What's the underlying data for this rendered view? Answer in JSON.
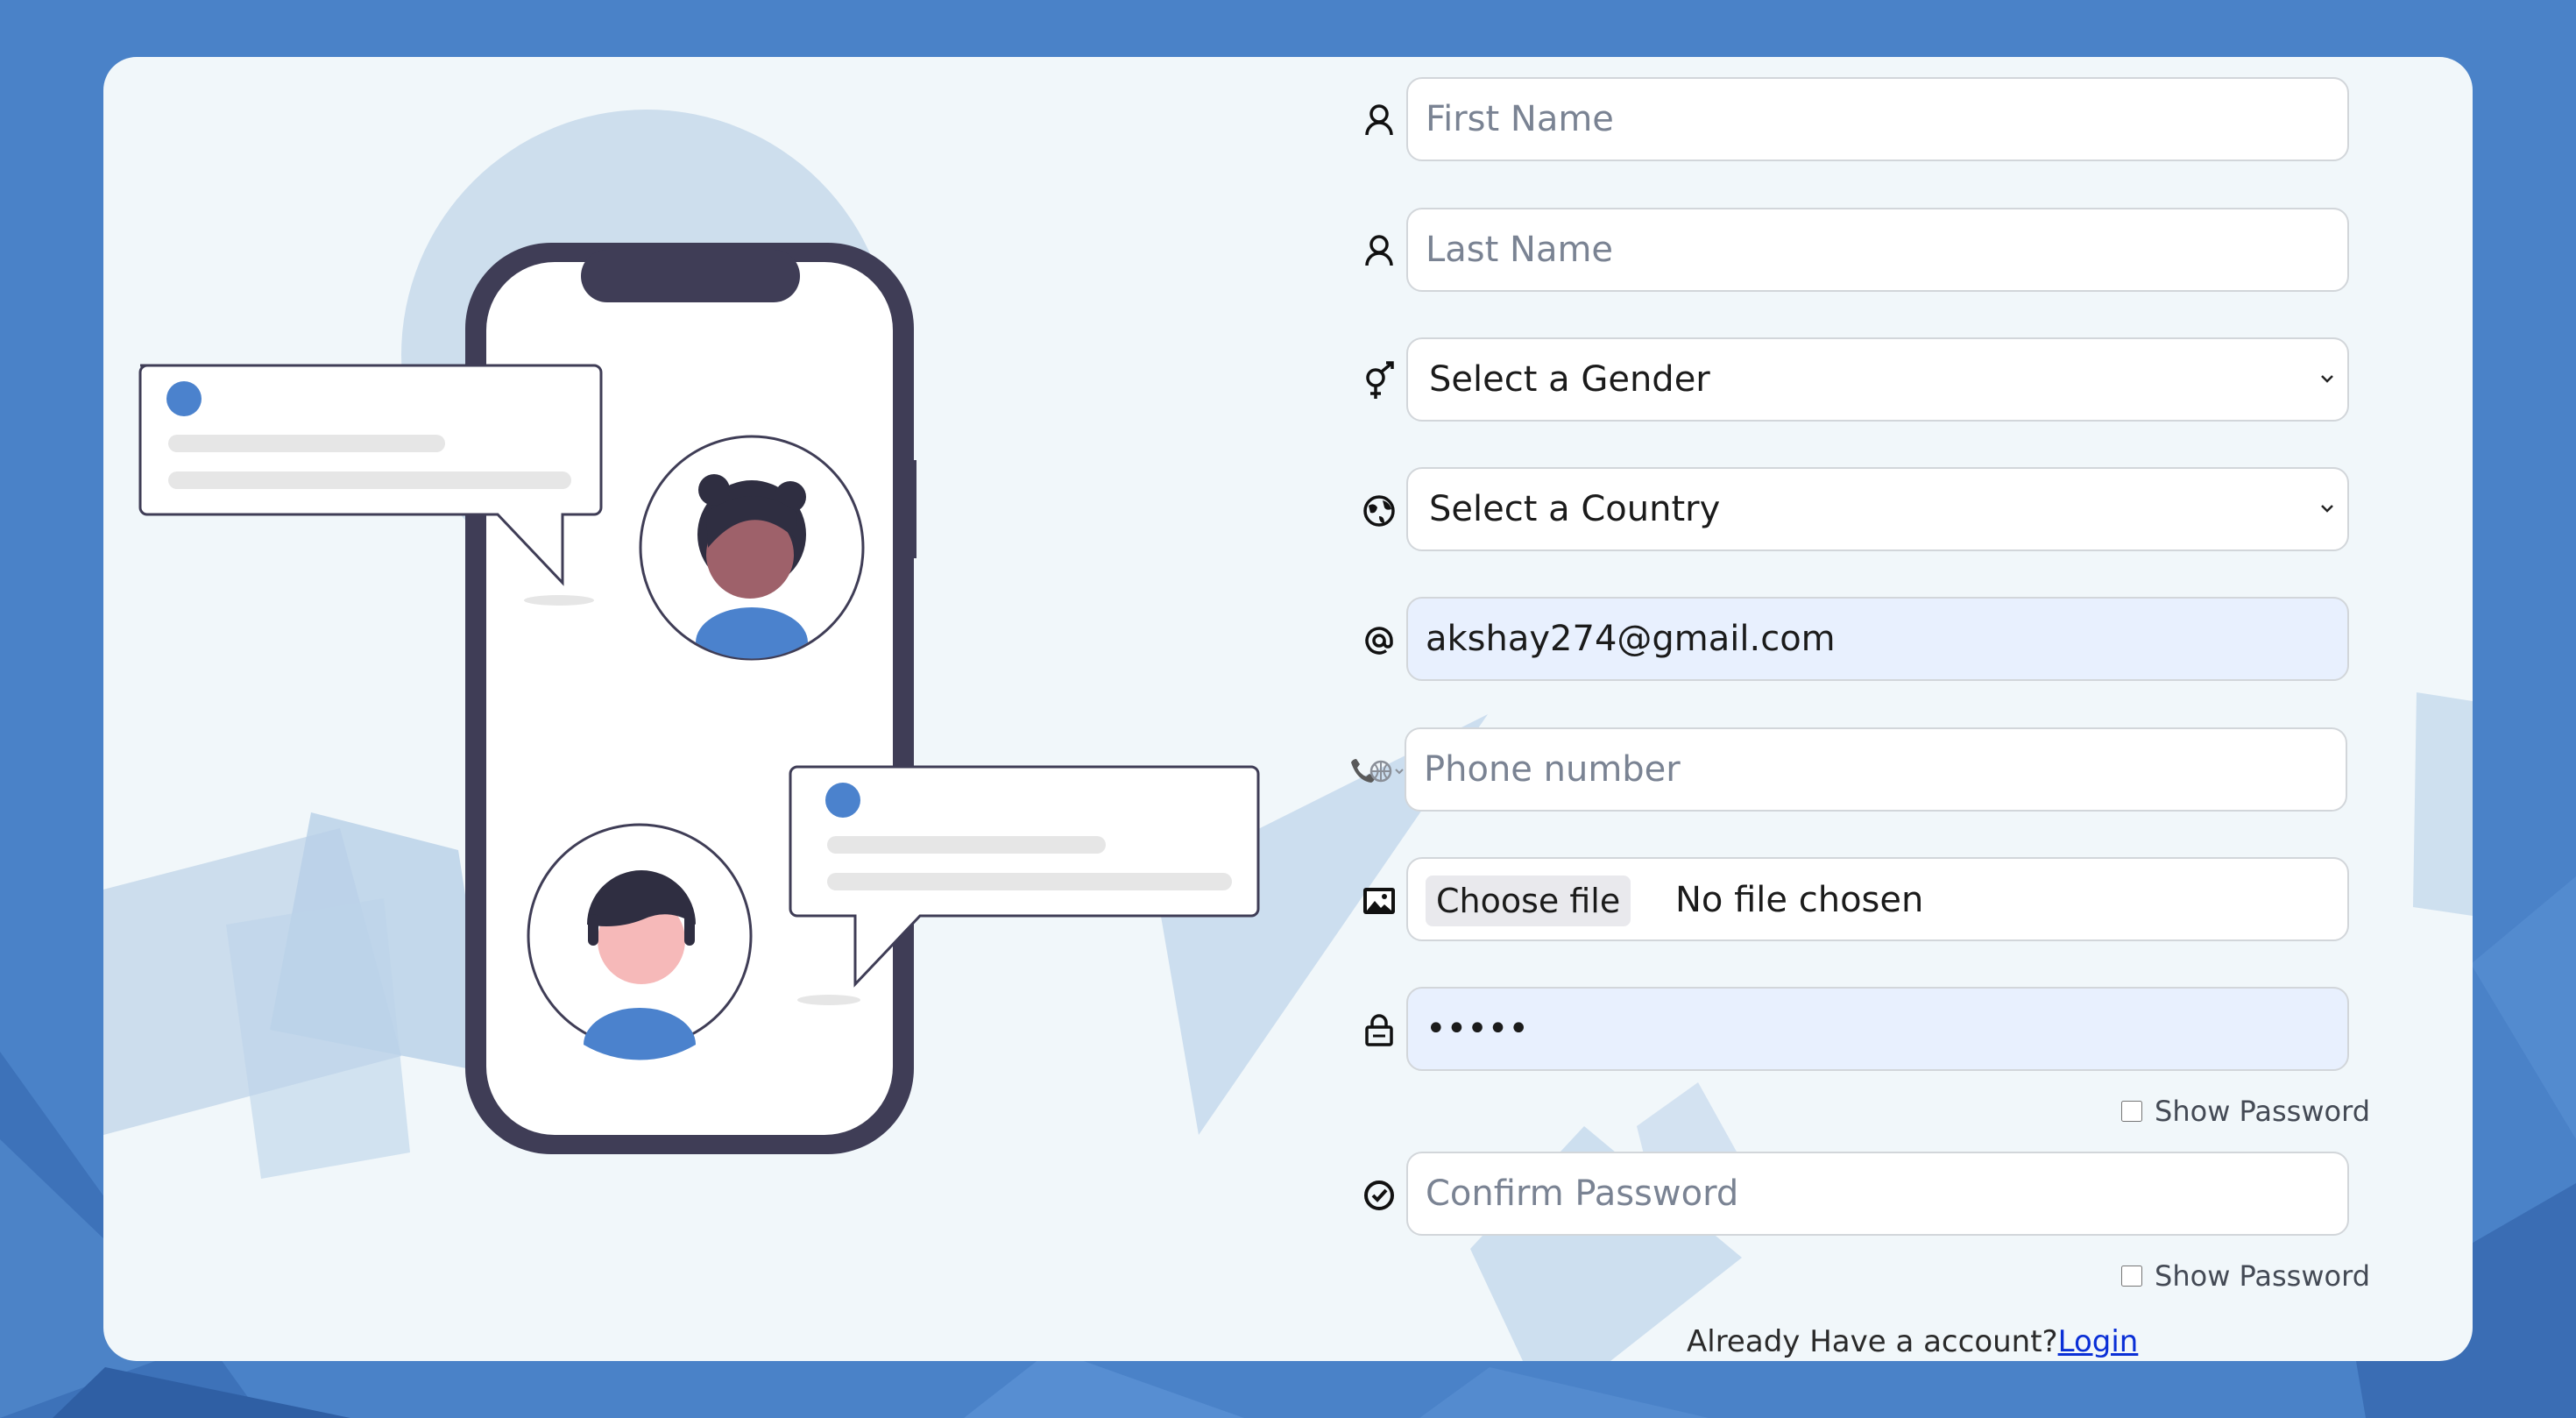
{
  "form": {
    "first_name": {
      "placeholder": "First Name",
      "value": ""
    },
    "last_name": {
      "placeholder": "Last Name",
      "value": ""
    },
    "gender": {
      "selected": "Select a Gender"
    },
    "country": {
      "selected": "Select a Country"
    },
    "email": {
      "value": "akshay274@gmail.com"
    },
    "phone": {
      "placeholder": "Phone number",
      "value": ""
    },
    "file": {
      "button_label": "Choose file",
      "status": "No file chosen"
    },
    "password": {
      "value": "•••••"
    },
    "show_password_label": "Show Password",
    "confirm_password": {
      "placeholder": "Confirm Password",
      "value": ""
    },
    "confirm_show_password_label": "Show Password"
  },
  "footer": {
    "prompt": "Already Have a account?",
    "login_link": "Login"
  },
  "colors": {
    "page_background": "#4a82c8",
    "card_background": "#f1f7fa",
    "accent_blue": "#4b82cd",
    "phone_frame": "#3f3d56",
    "autofill_background": "#e8f0fe"
  },
  "icons": {
    "first_name": "user-icon",
    "last_name": "user-icon",
    "gender": "gender-icon",
    "country": "globe-icon",
    "email": "at-icon",
    "phone": "phone-globe-icon",
    "file": "image-icon",
    "password": "lock-icon",
    "confirm": "check-circle-icon"
  }
}
